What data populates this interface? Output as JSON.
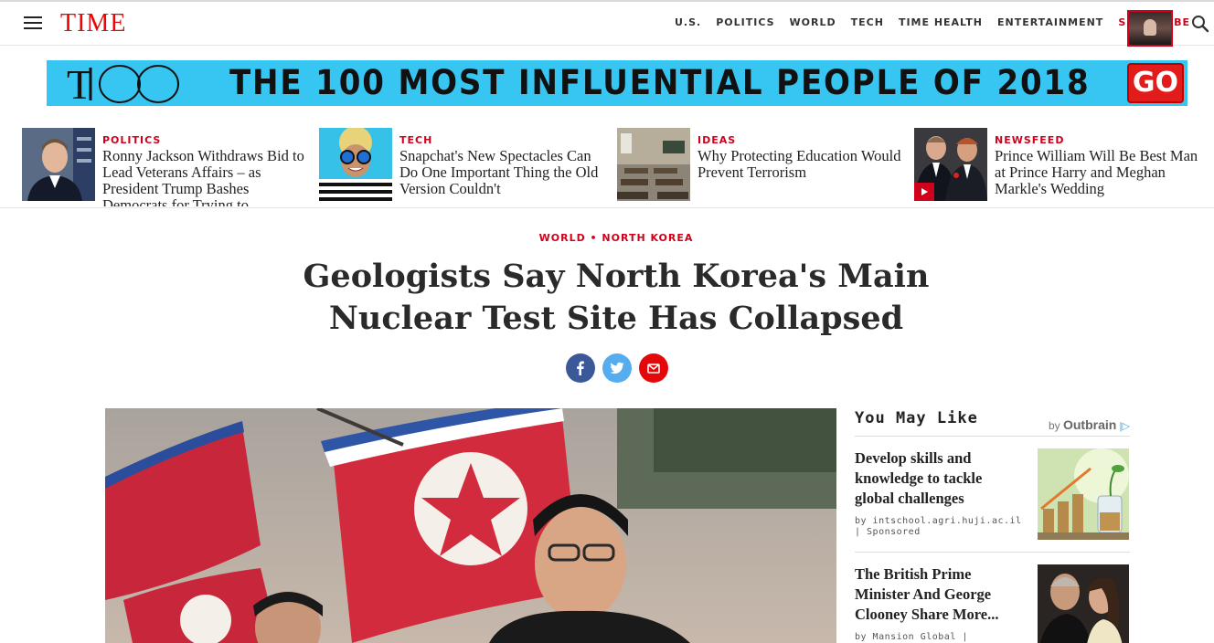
{
  "header": {
    "logo": "TIME",
    "nav": [
      {
        "label": "U.S.",
        "name": "nav-us"
      },
      {
        "label": "POLITICS",
        "name": "nav-politics"
      },
      {
        "label": "WORLD",
        "name": "nav-world"
      },
      {
        "label": "TECH",
        "name": "nav-tech"
      },
      {
        "label": "TIME HEALTH",
        "name": "nav-time-health"
      },
      {
        "label": "ENTERTAINMENT",
        "name": "nav-entertainment"
      }
    ],
    "subscribe": "SUBSCRIBE"
  },
  "banner": {
    "logo_text": "T100",
    "text": "THE 100 MOST INFLUENTIAL PEOPLE OF 2018",
    "go": "GO",
    "bg_color": "#37c5f2"
  },
  "teasers": [
    {
      "category": "POLITICS",
      "headline": "Ronny Jackson Withdraws Bid to Lead Veterans Affairs – as President Trump Bashes Democrats for Trying to"
    },
    {
      "category": "TECH",
      "headline": "Snapchat's New Spectacles Can Do One Important Thing the Old Version Couldn't"
    },
    {
      "category": "IDEAS",
      "headline": "Why Protecting Education Would Prevent Terrorism"
    },
    {
      "category": "NEWSFEED",
      "headline": "Prince William Will Be Best Man at Prince Harry and Meghan Markle's Wedding"
    }
  ],
  "article": {
    "kicker_section": "WORLD",
    "kicker_sep": " • ",
    "kicker_topic": "NORTH KOREA",
    "headline": "Geologists Say North Korea's Main Nuclear Test Site Has Collapsed"
  },
  "you_may_like": {
    "title": "You May Like",
    "by": "by",
    "provider": "Outbrain",
    "items": [
      {
        "title": "Develop skills and knowledge to tackle global challenges",
        "source": "by intschool.agri.huji.ac.il | Sponsored"
      },
      {
        "title": "The British Prime Minister And George Clooney Share More...",
        "source": "by Mansion Global |"
      }
    ]
  },
  "colors": {
    "accent": "#d0021b",
    "facebook": "#3b5998",
    "twitter": "#55acee",
    "email": "#e4080a"
  }
}
